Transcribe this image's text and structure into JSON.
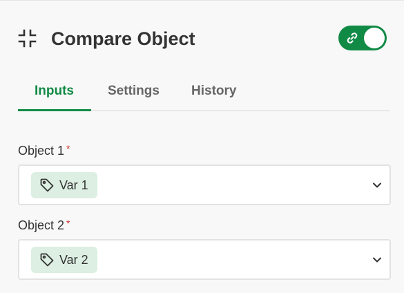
{
  "header": {
    "title": "Compare Object",
    "collapse_icon": "collapse-arrows-icon",
    "toggle": {
      "state": "on",
      "icon": "link-icon",
      "color": "#118a45"
    }
  },
  "tabs": [
    {
      "label": "Inputs",
      "active": true
    },
    {
      "label": "Settings",
      "active": false
    },
    {
      "label": "History",
      "active": false
    }
  ],
  "fields": [
    {
      "label": "Object 1",
      "required_mark": "*",
      "value": "Var 1",
      "value_icon": "tag-icon"
    },
    {
      "label": "Object 2",
      "required_mark": "*",
      "value": "Var 2",
      "value_icon": "tag-icon"
    }
  ],
  "colors": {
    "accent": "#118a45",
    "chip_bg": "#dcefe2",
    "required": "#d12f2f"
  }
}
